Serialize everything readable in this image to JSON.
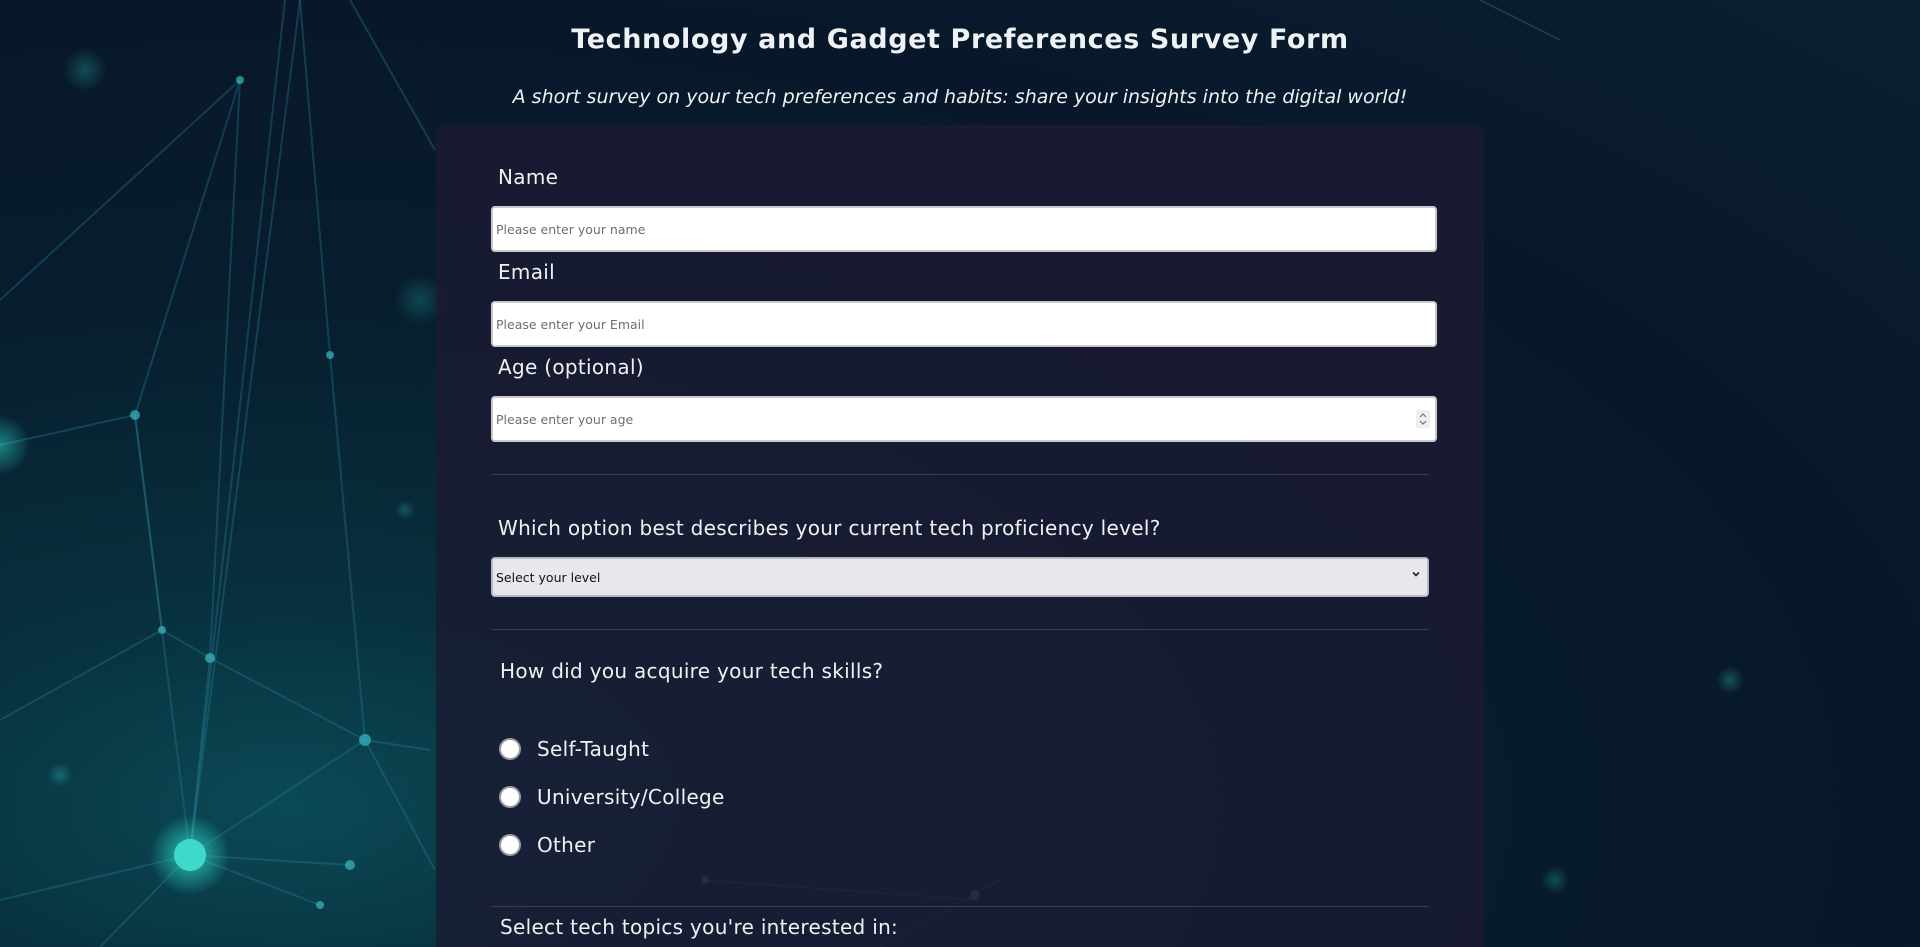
{
  "header": {
    "title": "Technology and Gadget Preferences Survey Form",
    "subtitle": "A short survey on your tech preferences and habits: share your insights into the digital world!"
  },
  "form": {
    "name": {
      "label": "Name",
      "placeholder": "Please enter your name"
    },
    "email": {
      "label": "Email",
      "placeholder": "Please enter your Email"
    },
    "age": {
      "label": "Age (optional)",
      "placeholder": "Please enter your age"
    },
    "proficiency": {
      "question": "Which option best describes your current tech proficiency level?",
      "selected": "Select your level"
    },
    "acquire": {
      "question": "How did you acquire your tech skills?",
      "options": [
        "Self-Taught",
        "University/College",
        "Other"
      ]
    },
    "topics": {
      "question": "Select tech topics you're interested in:"
    }
  },
  "icons": {
    "select_chevron": "chevron-down-icon",
    "number_spinner": "spinner-icon"
  },
  "colors": {
    "background": "#08182a",
    "card": "#1b1b32",
    "text": "#f1f1f5"
  }
}
